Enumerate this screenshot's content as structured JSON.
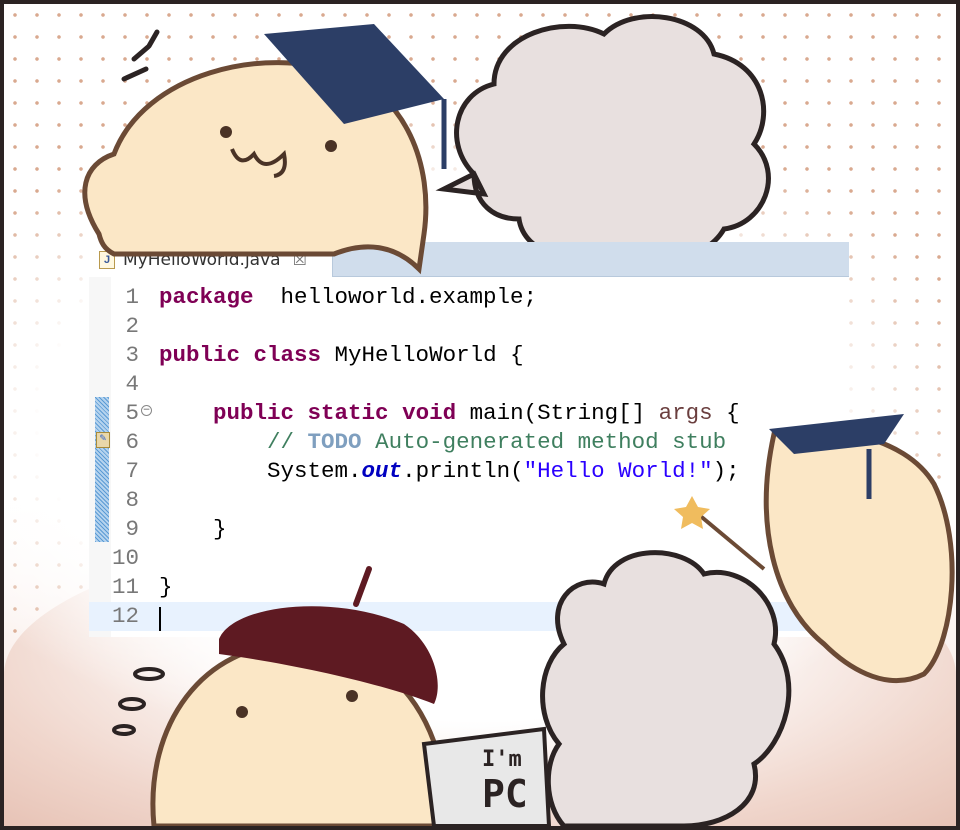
{
  "editor": {
    "tab": {
      "icon": "java-file-icon",
      "label": "MyHelloWorld.java",
      "close_glyph": "☒"
    },
    "current_line": 12,
    "lines": [
      {
        "n": "1",
        "tokens": [
          [
            "kw",
            "package"
          ],
          [
            "",
            "  helloworld.example;"
          ]
        ]
      },
      {
        "n": "2",
        "tokens": []
      },
      {
        "n": "3",
        "tokens": [
          [
            "kw",
            "public"
          ],
          [
            "",
            " "
          ],
          [
            "kw",
            "class"
          ],
          [
            "",
            " MyHelloWorld {"
          ]
        ]
      },
      {
        "n": "4",
        "tokens": []
      },
      {
        "n": "5",
        "tokens": [
          [
            "",
            "    "
          ],
          [
            "kw",
            "public"
          ],
          [
            "",
            " "
          ],
          [
            "kw",
            "static"
          ],
          [
            "",
            " "
          ],
          [
            "kw",
            "void"
          ],
          [
            "",
            " main(String[] "
          ],
          [
            "arg",
            "args"
          ],
          [
            "",
            " {"
          ]
        ]
      },
      {
        "n": "6",
        "tokens": [
          [
            "",
            "        "
          ],
          [
            "cm",
            "// "
          ],
          [
            "todo",
            "TODO"
          ],
          [
            "cm",
            " Auto-generated method stub"
          ]
        ]
      },
      {
        "n": "7",
        "tokens": [
          [
            "",
            "        System."
          ],
          [
            "fld",
            "out"
          ],
          [
            "",
            ".println("
          ],
          [
            "str",
            "\"Hello World!\""
          ],
          [
            "",
            ");"
          ]
        ]
      },
      {
        "n": "8",
        "tokens": []
      },
      {
        "n": "9",
        "tokens": [
          [
            "",
            "    }"
          ]
        ]
      },
      {
        "n": "10",
        "tokens": []
      },
      {
        "n": "11",
        "tokens": [
          [
            "",
            "}"
          ]
        ]
      },
      {
        "n": "12",
        "tokens": []
      }
    ]
  },
  "sign": {
    "line1": "I'm",
    "line2": "PC"
  },
  "colors": {
    "keyword": "#7f0055",
    "comment": "#3f7f5f",
    "string": "#2a00ff",
    "tabbar": "#d0ddec",
    "frame": "#2b2323"
  }
}
